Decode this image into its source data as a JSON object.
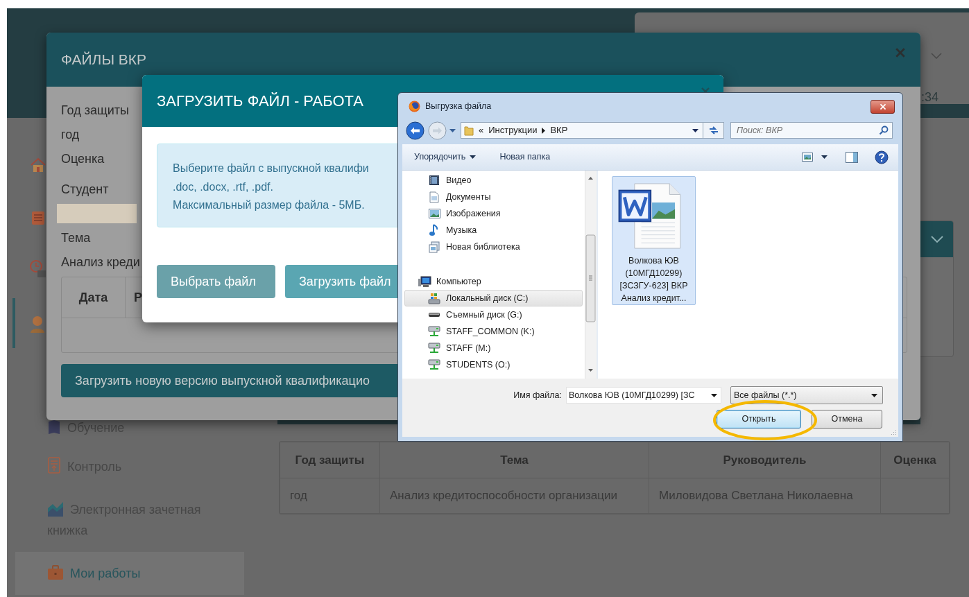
{
  "page": {
    "header_time": ":34",
    "sidebar": [
      {
        "label": "Обучение",
        "kind": "book",
        "selected": false
      },
      {
        "label": "Контроль",
        "kind": "report",
        "selected": false
      },
      {
        "label": "Электронная зачетная книжка",
        "kind": "chart",
        "selected": false
      },
      {
        "label": "Мои работы",
        "kind": "briefcase",
        "selected": true
      }
    ],
    "table": {
      "columns": [
        "Год защиты",
        "Тема",
        "Руководитель",
        "Оценка"
      ],
      "rows": [
        [
          "год",
          "Анализ кредитоспособности организации",
          "Миловидова Светлана Николаевна"
        ]
      ]
    }
  },
  "files_modal": {
    "title": "ФАЙЛЫ ВКР",
    "fields": [
      {
        "label": "Год защиты",
        "kind": "text",
        "value": "год"
      },
      {
        "label": "Оценка",
        "kind": "empty"
      },
      {
        "label": "Студент",
        "kind": "blurred"
      },
      {
        "label": "Тема",
        "kind": "text",
        "value": "Анализ креди"
      }
    ],
    "table": {
      "columns": [
        "Дата",
        "Р"
      ]
    },
    "upload_button": "Загрузить новую версию выпускной квалификацио"
  },
  "upload_modal": {
    "title": "ЗАГРУЗИТЬ ФАЙЛ - РАБОТА",
    "info_lines": [
      "Выберите файл с выпускной квалифи",
      ".doc, .docx, .rtf, .pdf.",
      "Максимальный размер файла - 5МБ."
    ],
    "buttons": [
      "Выбрать файл",
      "Загрузить файл"
    ]
  },
  "file_dialog": {
    "title": "Выгрузка файла",
    "path_prefix": "«",
    "path": [
      "Инструкции",
      "ВКР"
    ],
    "search_placeholder": "Поиск: ВКР",
    "toolbar": [
      "Упорядочить",
      "Новая папка"
    ],
    "nav": [
      {
        "label": "Видео",
        "kind": "video",
        "selected": false
      },
      {
        "label": "Документы",
        "kind": "documents",
        "selected": false
      },
      {
        "label": "Изображения",
        "kind": "images",
        "selected": false
      },
      {
        "label": "Музыка",
        "kind": "music",
        "selected": false
      },
      {
        "label": "Новая библиотека",
        "kind": "library",
        "selected": false
      },
      {
        "label": "Компьютер",
        "kind": "computer",
        "selected": false,
        "children": [
          {
            "label": "Локальный диск (C:)",
            "kind": "system-disk",
            "selected": true
          },
          {
            "label": "Съемный диск (G:)",
            "kind": "removable-disk",
            "selected": false
          },
          {
            "label": "STAFF_COMMON (K:)",
            "kind": "network-drive",
            "selected": false
          },
          {
            "label": "STAFF (M:)",
            "kind": "network-drive",
            "selected": false
          },
          {
            "label": "STUDENTS (O:)",
            "kind": "network-drive",
            "selected": false
          }
        ]
      }
    ],
    "files": [
      {
        "name": "Волкова ЮВ (10МГД10299) [ЗСЗГУ-623] ВКР Анализ кредит...",
        "selected": true
      }
    ],
    "filename_label": "Имя файла:",
    "filename_value": "Волкова ЮВ (10МГД10299) [ЗС",
    "filter": "Все файлы (*.*)",
    "buttons": [
      {
        "label": "Открыть",
        "default": true
      },
      {
        "label": "Отмена",
        "default": false
      }
    ]
  }
}
